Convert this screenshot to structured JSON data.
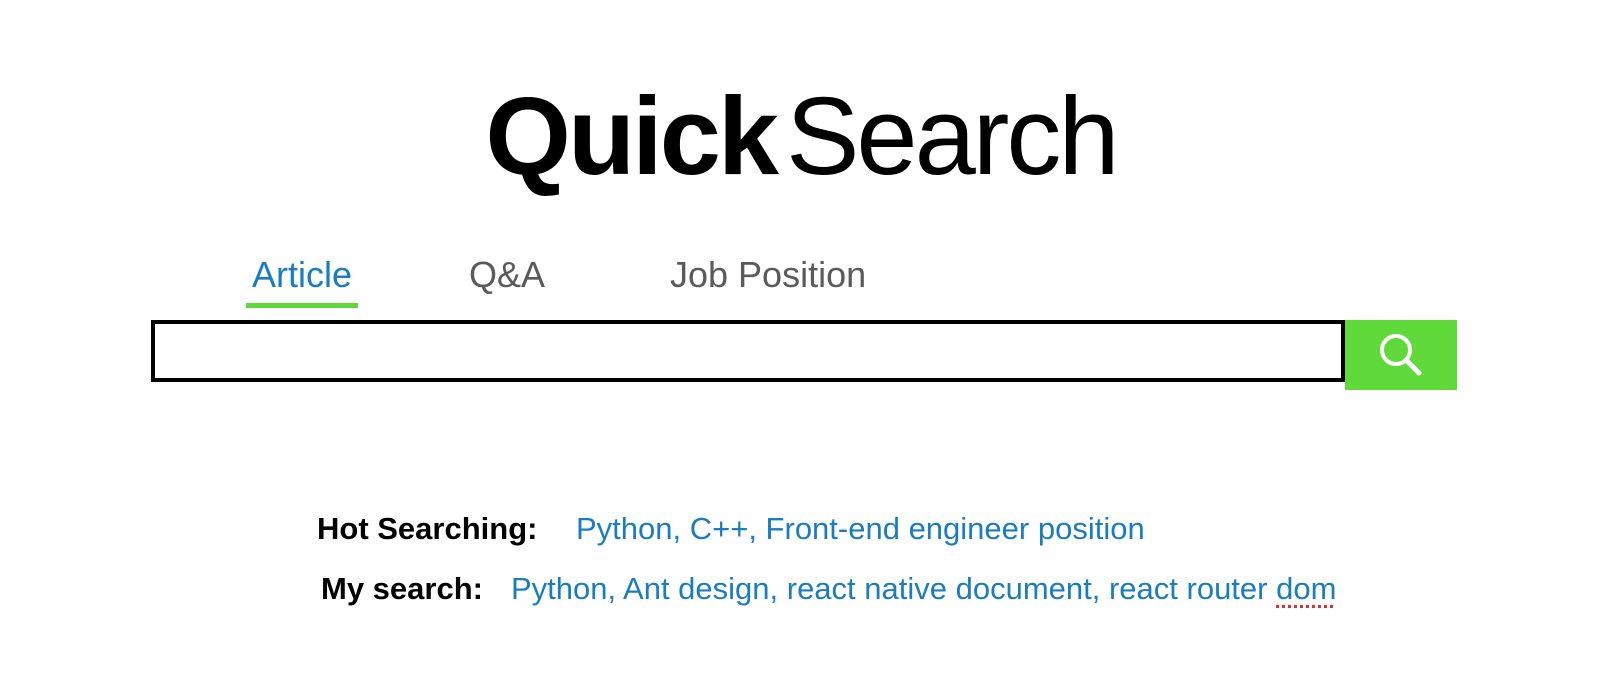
{
  "logo": {
    "bold": "Quick",
    "light": "Search"
  },
  "tabs": [
    {
      "label": "Article",
      "active": true
    },
    {
      "label": "Q&A",
      "active": false
    },
    {
      "label": "Job Position",
      "active": false
    }
  ],
  "search": {
    "value": "",
    "placeholder": "",
    "button_icon": "search-icon"
  },
  "hot_searching": {
    "label": "Hot Searching:",
    "items": "Python, C++, Front-end engineer position"
  },
  "my_search": {
    "label": "My search:",
    "items_main": "Python, Ant design, react native document, react router ",
    "items_last": "dom"
  },
  "colors": {
    "accent_green": "#60d93a",
    "link_blue": "#1a7cc1",
    "tab_gray": "#5a5a5a"
  }
}
